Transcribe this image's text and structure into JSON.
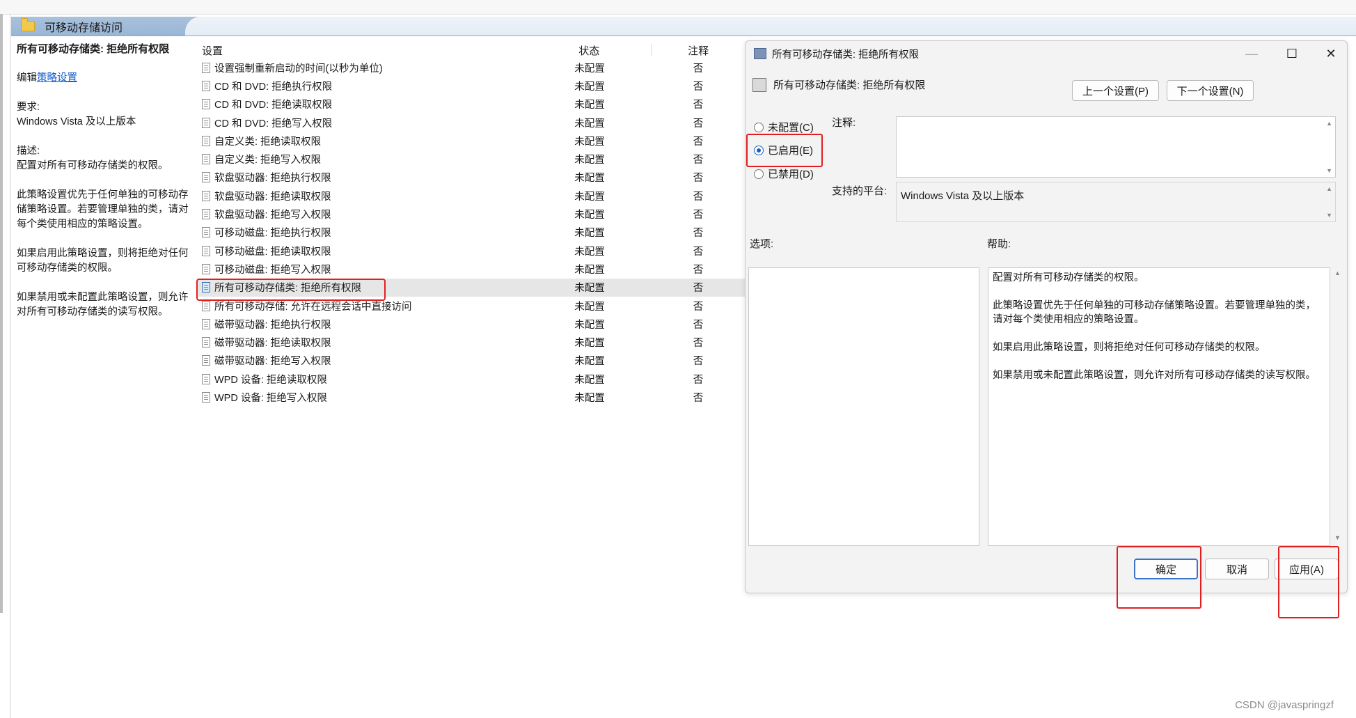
{
  "window": {
    "header_title": "可移动存储访问"
  },
  "description": {
    "title": "所有可移动存储类: 拒绝所有权限",
    "edit_prefix": "编辑",
    "edit_link": "策略设置",
    "requirements_label": "要求:",
    "requirements_value": "Windows Vista 及以上版本",
    "desc_label": "描述:",
    "desc_text": "配置对所有可移动存储类的权限。",
    "para1": "此策略设置优先于任何单独的可移动存储策略设置。若要管理单独的类，请对每个类使用相应的策略设置。",
    "para2": "如果启用此策略设置，则将拒绝对任何可移动存储类的权限。",
    "para3": "如果禁用或未配置此策略设置，则允许对所有可移动存储类的读写权限。"
  },
  "list": {
    "headers": {
      "name": "设置",
      "state": "状态",
      "note": "注释"
    },
    "rows": [
      {
        "name": "设置强制重新启动的时间(以秒为单位)",
        "state": "未配置",
        "note": "否"
      },
      {
        "name": "CD 和 DVD: 拒绝执行权限",
        "state": "未配置",
        "note": "否"
      },
      {
        "name": "CD 和 DVD: 拒绝读取权限",
        "state": "未配置",
        "note": "否"
      },
      {
        "name": "CD 和 DVD: 拒绝写入权限",
        "state": "未配置",
        "note": "否"
      },
      {
        "name": "自定义类: 拒绝读取权限",
        "state": "未配置",
        "note": "否"
      },
      {
        "name": "自定义类: 拒绝写入权限",
        "state": "未配置",
        "note": "否"
      },
      {
        "name": "软盘驱动器: 拒绝执行权限",
        "state": "未配置",
        "note": "否"
      },
      {
        "name": "软盘驱动器: 拒绝读取权限",
        "state": "未配置",
        "note": "否"
      },
      {
        "name": "软盘驱动器: 拒绝写入权限",
        "state": "未配置",
        "note": "否"
      },
      {
        "name": "可移动磁盘: 拒绝执行权限",
        "state": "未配置",
        "note": "否"
      },
      {
        "name": "可移动磁盘: 拒绝读取权限",
        "state": "未配置",
        "note": "否"
      },
      {
        "name": "可移动磁盘: 拒绝写入权限",
        "state": "未配置",
        "note": "否"
      },
      {
        "name": "所有可移动存储类: 拒绝所有权限",
        "state": "未配置",
        "note": "否"
      },
      {
        "name": "所有可移动存储: 允许在远程会话中直接访问",
        "state": "未配置",
        "note": "否"
      },
      {
        "name": "磁带驱动器: 拒绝执行权限",
        "state": "未配置",
        "note": "否"
      },
      {
        "name": "磁带驱动器: 拒绝读取权限",
        "state": "未配置",
        "note": "否"
      },
      {
        "name": "磁带驱动器: 拒绝写入权限",
        "state": "未配置",
        "note": "否"
      },
      {
        "name": "WPD 设备: 拒绝读取权限",
        "state": "未配置",
        "note": "否"
      },
      {
        "name": "WPD 设备: 拒绝写入权限",
        "state": "未配置",
        "note": "否"
      }
    ]
  },
  "dialog": {
    "title": "所有可移动存储类: 拒绝所有权限",
    "subtitle": "所有可移动存储类: 拒绝所有权限",
    "prev_button": "上一个设置(P)",
    "next_button": "下一个设置(N)",
    "radio_not_configured": "未配置(C)",
    "radio_enabled": "已启用(E)",
    "radio_disabled": "已禁用(D)",
    "selected_option": "已启用(E)",
    "comment_label": "注释:",
    "comment_value": "",
    "platform_label": "支持的平台:",
    "platform_value": "Windows Vista 及以上版本",
    "options_label": "选项:",
    "help_label": "帮助:",
    "help_text": "配置对所有可移动存储类的权限。\n\n此策略设置优先于任何单独的可移动存储策略设置。若要管理单独的类，请对每个类使用相应的策略设置。\n\n如果启用此策略设置，则将拒绝对任何可移动存储类的权限。\n\n如果禁用或未配置此策略设置，则允许对所有可移动存储类的读写权限。",
    "ok_button": "确定",
    "cancel_button": "取消",
    "apply_button": "应用(A)",
    "minimize": "—",
    "maximize": "☐",
    "close": "✕"
  },
  "watermark": "CSDN @javaspringzf",
  "colors": {
    "highlight": "#e02020",
    "accent": "#1d5fb9"
  }
}
